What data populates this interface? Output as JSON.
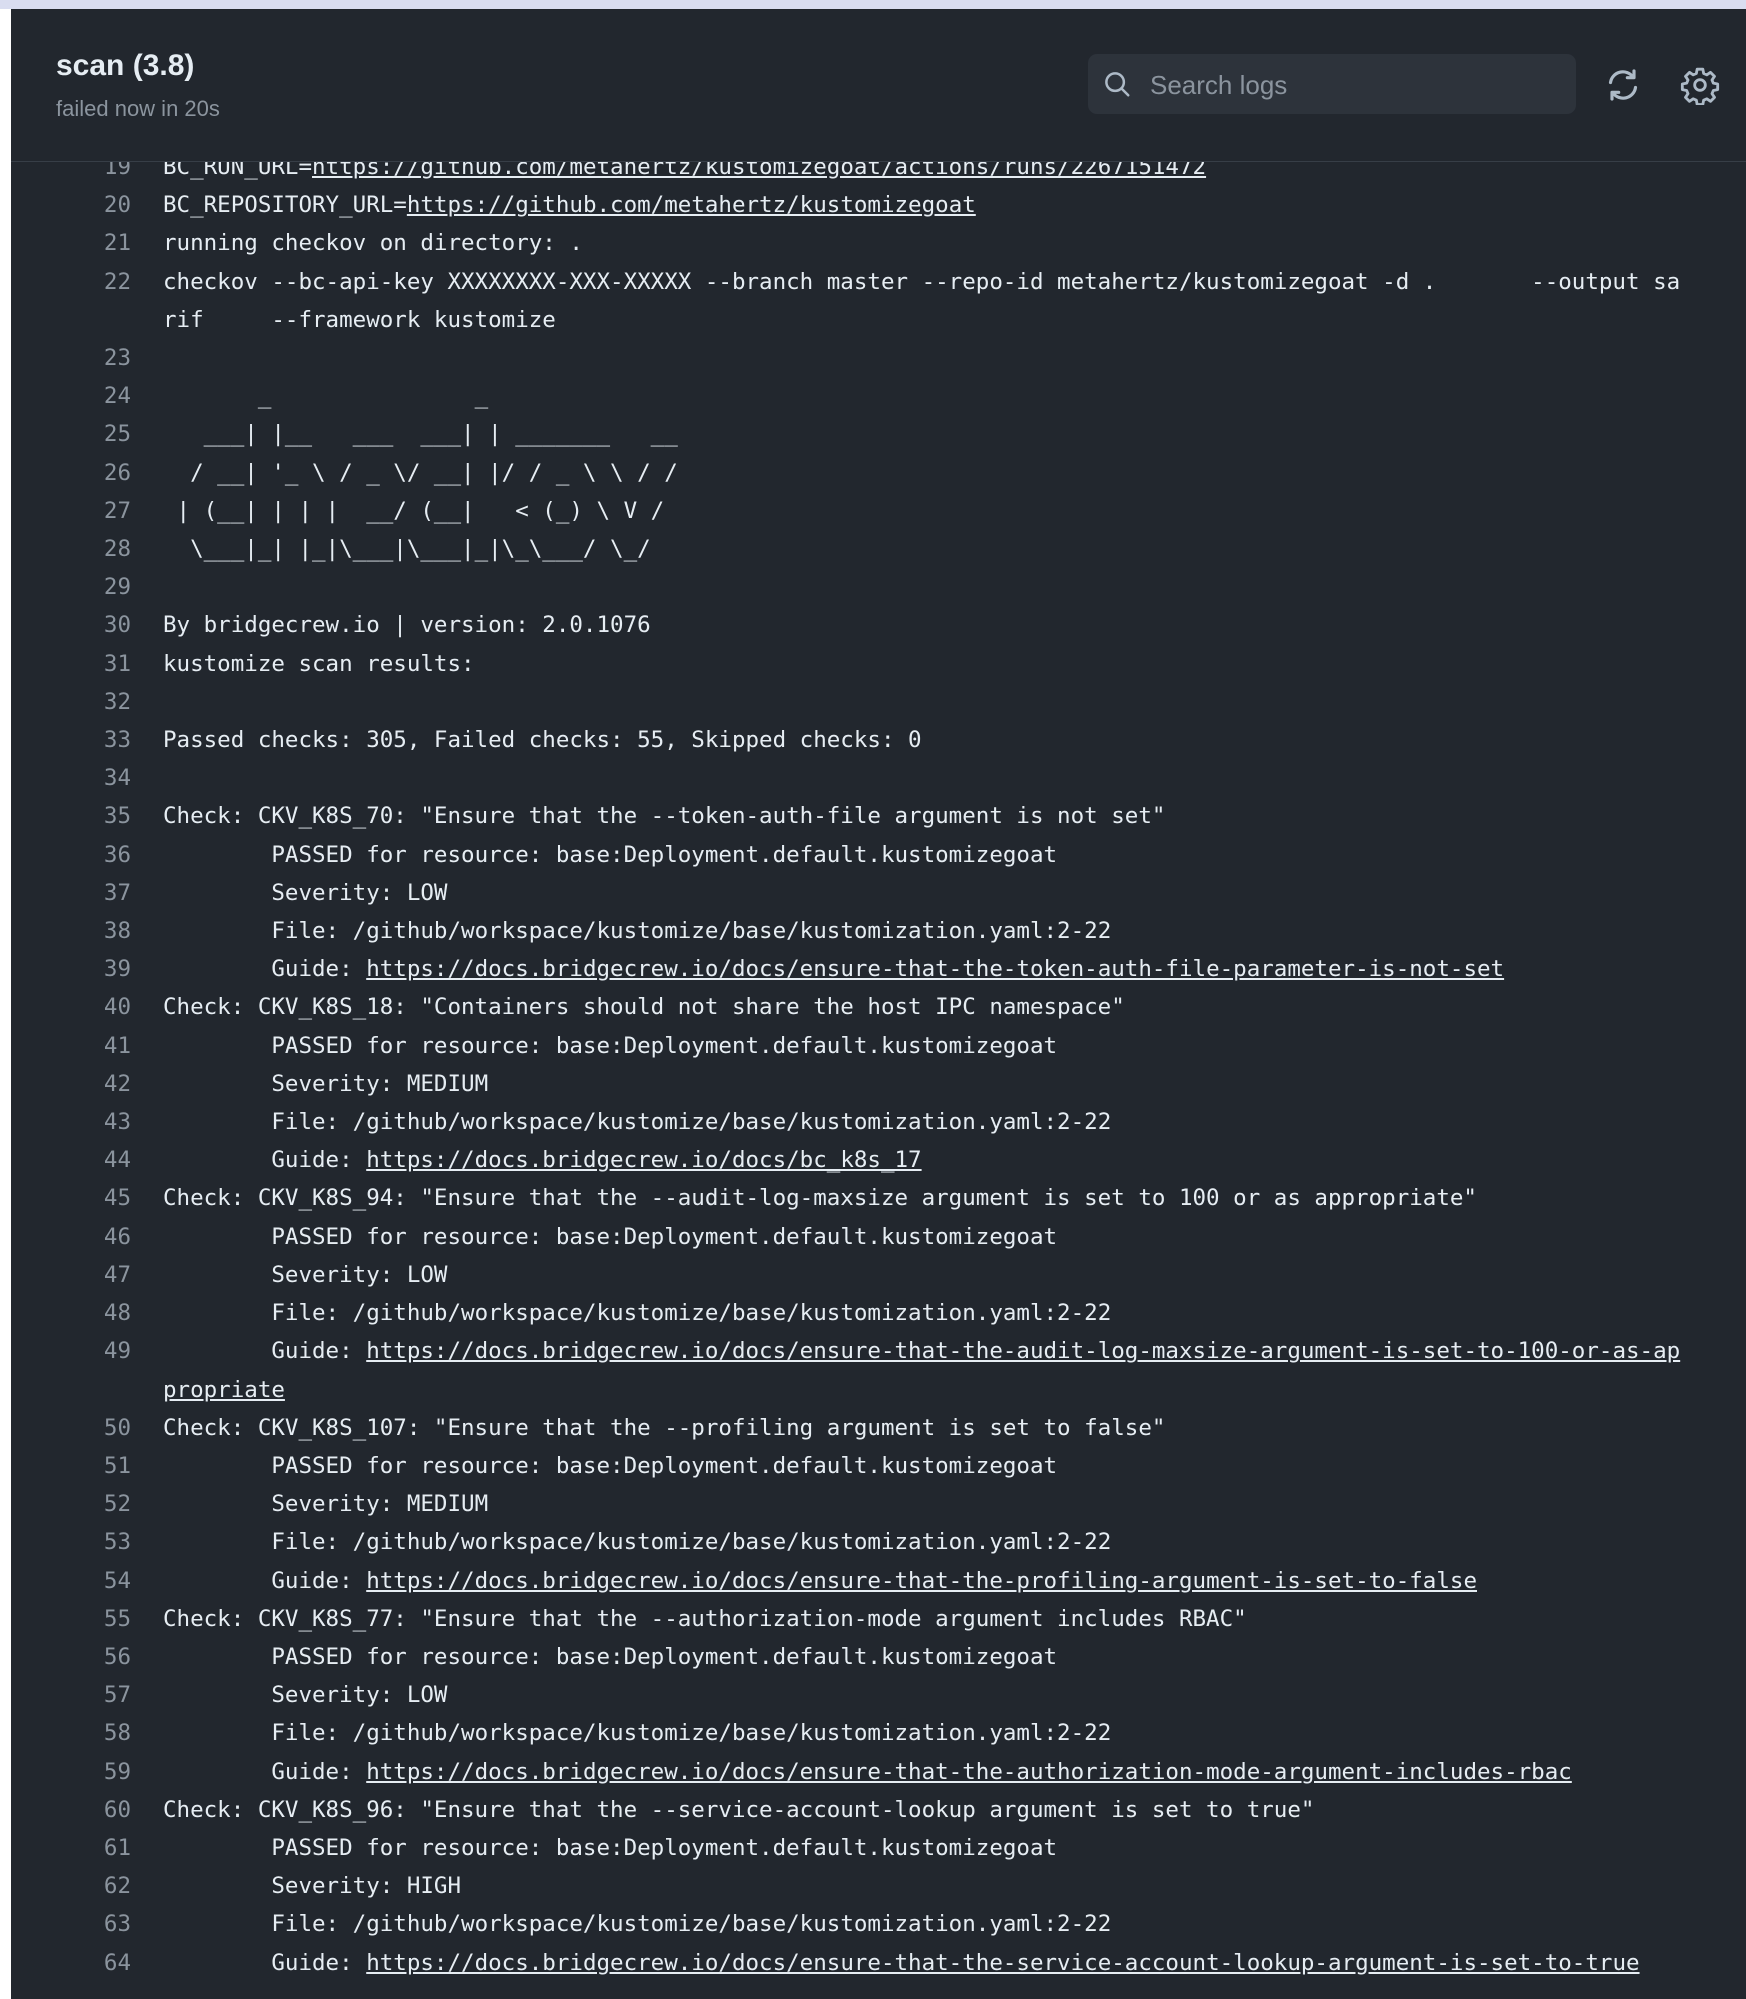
{
  "job": {
    "title": "scan (3.8)",
    "status": "failed now in 20s"
  },
  "search": {
    "placeholder": "Search logs"
  },
  "icons": {
    "search": "search-icon",
    "refresh": "refresh-icon",
    "settings": "gear-icon"
  },
  "colors": {
    "background": "#22272e",
    "text": "#e6edf3",
    "muted": "#8b949e"
  },
  "lines": [
    {
      "n": "19",
      "t": "BC_RUN_URL=",
      "url": "https://github.com/metahertz/kustomizegoat/actions/runs/2267151472"
    },
    {
      "n": "20",
      "t": "BC_REPOSITORY_URL=",
      "url": "https://github.com/metahertz/kustomizegoat"
    },
    {
      "n": "21",
      "t": "running checkov on directory: ."
    },
    {
      "n": "22",
      "t": "checkov --bc-api-key XXXXXXXX-XXX-XXXXX --branch master --repo-id metahertz/kustomizegoat -d .       --output sarif     --framework kustomize"
    },
    {
      "n": "23",
      "t": ""
    },
    {
      "n": "24",
      "t": "       _               _"
    },
    {
      "n": "25",
      "t": "   ___| |__   ___  ___| | _______   __"
    },
    {
      "n": "26",
      "t": "  / __| '_ \\ / _ \\/ __| |/ / _ \\ \\ / /"
    },
    {
      "n": "27",
      "t": " | (__| | | |  __/ (__|   < (_) \\ V /"
    },
    {
      "n": "28",
      "t": "  \\___|_| |_|\\___|\\___|_|\\_\\___/ \\_/"
    },
    {
      "n": "29",
      "t": ""
    },
    {
      "n": "30",
      "t": "By bridgecrew.io | version: 2.0.1076"
    },
    {
      "n": "31",
      "t": "kustomize scan results:"
    },
    {
      "n": "32",
      "t": ""
    },
    {
      "n": "33",
      "t": "Passed checks: 305, Failed checks: 55, Skipped checks: 0"
    },
    {
      "n": "34",
      "t": ""
    },
    {
      "n": "35",
      "t": "Check: CKV_K8S_70: \"Ensure that the --token-auth-file argument is not set\""
    },
    {
      "n": "36",
      "t": "        PASSED for resource: base:Deployment.default.kustomizegoat"
    },
    {
      "n": "37",
      "t": "        Severity: LOW"
    },
    {
      "n": "38",
      "t": "        File: /github/workspace/kustomize/base/kustomization.yaml:2-22"
    },
    {
      "n": "39",
      "t": "        Guide: ",
      "url": "https://docs.bridgecrew.io/docs/ensure-that-the-token-auth-file-parameter-is-not-set"
    },
    {
      "n": "40",
      "t": "Check: CKV_K8S_18: \"Containers should not share the host IPC namespace\""
    },
    {
      "n": "41",
      "t": "        PASSED for resource: base:Deployment.default.kustomizegoat"
    },
    {
      "n": "42",
      "t": "        Severity: MEDIUM"
    },
    {
      "n": "43",
      "t": "        File: /github/workspace/kustomize/base/kustomization.yaml:2-22"
    },
    {
      "n": "44",
      "t": "        Guide: ",
      "url": "https://docs.bridgecrew.io/docs/bc_k8s_17"
    },
    {
      "n": "45",
      "t": "Check: CKV_K8S_94: \"Ensure that the --audit-log-maxsize argument is set to 100 or as appropriate\""
    },
    {
      "n": "46",
      "t": "        PASSED for resource: base:Deployment.default.kustomizegoat"
    },
    {
      "n": "47",
      "t": "        Severity: LOW"
    },
    {
      "n": "48",
      "t": "        File: /github/workspace/kustomize/base/kustomization.yaml:2-22"
    },
    {
      "n": "49",
      "t": "        Guide: ",
      "url": "https://docs.bridgecrew.io/docs/ensure-that-the-audit-log-maxsize-argument-is-set-to-100-or-as-appropriate"
    },
    {
      "n": "50",
      "t": "Check: CKV_K8S_107: \"Ensure that the --profiling argument is set to false\""
    },
    {
      "n": "51",
      "t": "        PASSED for resource: base:Deployment.default.kustomizegoat"
    },
    {
      "n": "52",
      "t": "        Severity: MEDIUM"
    },
    {
      "n": "53",
      "t": "        File: /github/workspace/kustomize/base/kustomization.yaml:2-22"
    },
    {
      "n": "54",
      "t": "        Guide: ",
      "url": "https://docs.bridgecrew.io/docs/ensure-that-the-profiling-argument-is-set-to-false"
    },
    {
      "n": "55",
      "t": "Check: CKV_K8S_77: \"Ensure that the --authorization-mode argument includes RBAC\""
    },
    {
      "n": "56",
      "t": "        PASSED for resource: base:Deployment.default.kustomizegoat"
    },
    {
      "n": "57",
      "t": "        Severity: LOW"
    },
    {
      "n": "58",
      "t": "        File: /github/workspace/kustomize/base/kustomization.yaml:2-22"
    },
    {
      "n": "59",
      "t": "        Guide: ",
      "url": "https://docs.bridgecrew.io/docs/ensure-that-the-authorization-mode-argument-includes-rbac"
    },
    {
      "n": "60",
      "t": "Check: CKV_K8S_96: \"Ensure that the --service-account-lookup argument is set to true\""
    },
    {
      "n": "61",
      "t": "        PASSED for resource: base:Deployment.default.kustomizegoat"
    },
    {
      "n": "62",
      "t": "        Severity: HIGH"
    },
    {
      "n": "63",
      "t": "        File: /github/workspace/kustomize/base/kustomization.yaml:2-22"
    },
    {
      "n": "64",
      "t": "        Guide: ",
      "url": "https://docs.bridgecrew.io/docs/ensure-that-the-service-account-lookup-argument-is-set-to-true"
    }
  ]
}
